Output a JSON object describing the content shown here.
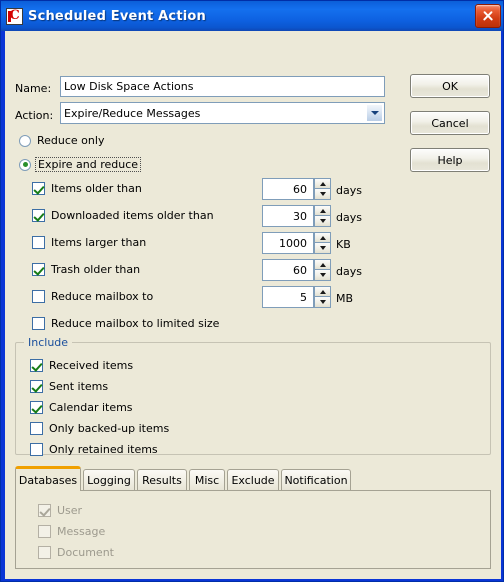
{
  "window": {
    "title": "Scheduled Event Action",
    "app_icon": "application-c-icon",
    "close_label": "Close",
    "accent_blue": "#0a35d6",
    "dialog_bg": "#ece9d8",
    "legend_color": "#1b4f9c",
    "active_tab_accent": "#f0a000"
  },
  "form": {
    "name_label": "Name:",
    "name_value": "Low Disk Space Actions",
    "name_placeholder": "",
    "action_label": "Action:",
    "action_value": "Expire/Reduce Messages",
    "action_options": [
      "Expire/Reduce Messages"
    ]
  },
  "buttons": {
    "ok": "OK",
    "cancel": "Cancel",
    "help": "Help"
  },
  "mode": {
    "reduce_only": {
      "label": "Reduce only",
      "selected": false
    },
    "expire_and_reduce": {
      "label": "Expire and reduce",
      "selected": true,
      "focused": true
    }
  },
  "criteria": [
    {
      "label": "Items older than",
      "checked": true,
      "value": "60",
      "unit": "days"
    },
    {
      "label": "Downloaded items older than",
      "checked": true,
      "value": "30",
      "unit": "days"
    },
    {
      "label": "Items larger than",
      "checked": false,
      "value": "1000",
      "unit": "KB"
    },
    {
      "label": "Trash older than",
      "checked": true,
      "value": "60",
      "unit": "days"
    },
    {
      "label": "Reduce mailbox to",
      "checked": false,
      "value": "5",
      "unit": "MB"
    },
    {
      "label": "Reduce mailbox to limited size",
      "checked": false,
      "value": null,
      "unit": null
    }
  ],
  "include": {
    "legend": "Include",
    "items": [
      {
        "label": "Received items",
        "checked": true
      },
      {
        "label": "Sent items",
        "checked": true
      },
      {
        "label": "Calendar items",
        "checked": true
      },
      {
        "label": "Only backed-up items",
        "checked": false
      },
      {
        "label": "Only retained items",
        "checked": false
      }
    ]
  },
  "tabs": [
    {
      "label": "Databases",
      "active": true
    },
    {
      "label": "Logging",
      "active": false
    },
    {
      "label": "Results",
      "active": false
    },
    {
      "label": "Misc",
      "active": false
    },
    {
      "label": "Exclude",
      "active": false
    },
    {
      "label": "Notification",
      "active": false
    }
  ],
  "databases_panel": {
    "items": [
      {
        "label": "User",
        "checked": true,
        "disabled": true
      },
      {
        "label": "Message",
        "checked": false,
        "disabled": true
      },
      {
        "label": "Document",
        "checked": false,
        "disabled": true
      }
    ]
  }
}
